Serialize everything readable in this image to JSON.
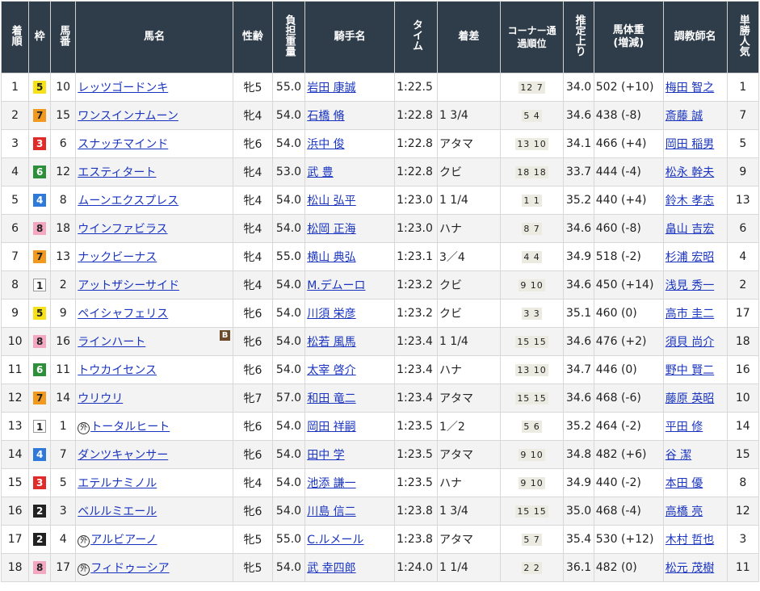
{
  "headers": {
    "finish": "着順",
    "waku": "枠",
    "umaban": "馬番",
    "horse": "馬名",
    "sexage": "性齢",
    "weight_carried": "負担重量",
    "jockey": "騎手名",
    "time": "タイム",
    "margin": "着差",
    "corner": "コーナー通過順位",
    "last3f": "推定上り",
    "body_weight_1": "馬体重",
    "body_weight_2": "(増減)",
    "trainer": "調教師名",
    "popularity": "単勝人気"
  },
  "rows": [
    {
      "finish": "1",
      "waku": "5",
      "umaban": "10",
      "foreign": "",
      "horse": "レッツゴードンキ",
      "blinker": "",
      "sexage": "牝5",
      "kg": "55.0",
      "jockey": "岩田 康誠",
      "time": "1:22.5",
      "margin": "",
      "corner": "12 7",
      "last3f": "34.0",
      "bw": "502 (+10)",
      "trainer": "梅田 智之",
      "pop": "1"
    },
    {
      "finish": "2",
      "waku": "7",
      "umaban": "15",
      "foreign": "",
      "horse": "ワンスインナムーン",
      "blinker": "",
      "sexage": "牝4",
      "kg": "54.0",
      "jockey": "石橋 脩",
      "time": "1:22.8",
      "margin": "1 3/4",
      "corner": "5 4",
      "last3f": "34.6",
      "bw": "438 (-8)",
      "trainer": "斎藤 誠",
      "pop": "7"
    },
    {
      "finish": "3",
      "waku": "3",
      "umaban": "6",
      "foreign": "",
      "horse": "スナッチマインド",
      "blinker": "",
      "sexage": "牝6",
      "kg": "54.0",
      "jockey": "浜中 俊",
      "time": "1:22.8",
      "margin": "アタマ",
      "corner": "13 10",
      "last3f": "34.1",
      "bw": "466 (+4)",
      "trainer": "岡田 稲男",
      "pop": "5"
    },
    {
      "finish": "4",
      "waku": "6",
      "umaban": "12",
      "foreign": "",
      "horse": "エスティタート",
      "blinker": "",
      "sexage": "牝4",
      "kg": "53.0",
      "jockey": "武 豊",
      "time": "1:22.8",
      "margin": "クビ",
      "corner": "18 18",
      "last3f": "33.7",
      "bw": "444 (-4)",
      "trainer": "松永 幹夫",
      "pop": "9"
    },
    {
      "finish": "5",
      "waku": "4",
      "umaban": "8",
      "foreign": "",
      "horse": "ムーンエクスプレス",
      "blinker": "",
      "sexage": "牝4",
      "kg": "54.0",
      "jockey": "松山 弘平",
      "time": "1:23.0",
      "margin": "1 1/4",
      "corner": "1 1",
      "last3f": "35.2",
      "bw": "440 (+4)",
      "trainer": "鈴木 孝志",
      "pop": "13"
    },
    {
      "finish": "6",
      "waku": "8",
      "umaban": "18",
      "foreign": "",
      "horse": "ウインファビラス",
      "blinker": "",
      "sexage": "牝4",
      "kg": "54.0",
      "jockey": "松岡 正海",
      "time": "1:23.0",
      "margin": "ハナ",
      "corner": "8 7",
      "last3f": "34.6",
      "bw": "460 (-8)",
      "trainer": "畠山 吉宏",
      "pop": "6"
    },
    {
      "finish": "7",
      "waku": "7",
      "umaban": "13",
      "foreign": "",
      "horse": "ナックビーナス",
      "blinker": "",
      "sexage": "牝4",
      "kg": "55.0",
      "jockey": "横山 典弘",
      "time": "1:23.1",
      "margin": "3／4",
      "corner": "4 4",
      "last3f": "34.9",
      "bw": "518 (-2)",
      "trainer": "杉浦 宏昭",
      "pop": "4"
    },
    {
      "finish": "8",
      "waku": "1",
      "umaban": "2",
      "foreign": "",
      "horse": "アットザシーサイド",
      "blinker": "",
      "sexage": "牝4",
      "kg": "54.0",
      "jockey": "M.デムーロ",
      "time": "1:23.2",
      "margin": "クビ",
      "corner": "9 10",
      "last3f": "34.6",
      "bw": "450 (+14)",
      "trainer": "浅見 秀一",
      "pop": "2"
    },
    {
      "finish": "9",
      "waku": "5",
      "umaban": "9",
      "foreign": "",
      "horse": "ペイシャフェリス",
      "blinker": "",
      "sexage": "牝6",
      "kg": "54.0",
      "jockey": "川須 栄彦",
      "time": "1:23.2",
      "margin": "クビ",
      "corner": "3 3",
      "last3f": "35.1",
      "bw": "460 (0)",
      "trainer": "高市 圭二",
      "pop": "17"
    },
    {
      "finish": "10",
      "waku": "8",
      "umaban": "16",
      "foreign": "",
      "horse": "ラインハート",
      "blinker": "B",
      "sexage": "牝6",
      "kg": "54.0",
      "jockey": "松若 風馬",
      "time": "1:23.4",
      "margin": "1 1/4",
      "corner": "15 15",
      "last3f": "34.6",
      "bw": "476 (+2)",
      "trainer": "須貝 尚介",
      "pop": "18"
    },
    {
      "finish": "11",
      "waku": "6",
      "umaban": "11",
      "foreign": "",
      "horse": "トウカイセンス",
      "blinker": "",
      "sexage": "牝6",
      "kg": "54.0",
      "jockey": "太宰 啓介",
      "time": "1:23.4",
      "margin": "ハナ",
      "corner": "13 10",
      "last3f": "34.7",
      "bw": "446 (0)",
      "trainer": "野中 賢二",
      "pop": "16"
    },
    {
      "finish": "12",
      "waku": "7",
      "umaban": "14",
      "foreign": "",
      "horse": "ウリウリ",
      "blinker": "",
      "sexage": "牝7",
      "kg": "57.0",
      "jockey": "和田 竜二",
      "time": "1:23.4",
      "margin": "アタマ",
      "corner": "15 15",
      "last3f": "34.6",
      "bw": "468 (-6)",
      "trainer": "藤原 英昭",
      "pop": "10"
    },
    {
      "finish": "13",
      "waku": "1",
      "umaban": "1",
      "foreign": "外",
      "horse": "トータルヒート",
      "blinker": "",
      "sexage": "牝6",
      "kg": "54.0",
      "jockey": "岡田 祥嗣",
      "time": "1:23.5",
      "margin": "1／2",
      "corner": "5 6",
      "last3f": "35.2",
      "bw": "464 (-2)",
      "trainer": "平田 修",
      "pop": "14"
    },
    {
      "finish": "14",
      "waku": "4",
      "umaban": "7",
      "foreign": "",
      "horse": "ダンツキャンサー",
      "blinker": "",
      "sexage": "牝6",
      "kg": "54.0",
      "jockey": "田中 学",
      "time": "1:23.5",
      "margin": "アタマ",
      "corner": "9 10",
      "last3f": "34.8",
      "bw": "482 (+6)",
      "trainer": "谷 潔",
      "pop": "15"
    },
    {
      "finish": "15",
      "waku": "3",
      "umaban": "5",
      "foreign": "",
      "horse": "エテルナミノル",
      "blinker": "",
      "sexage": "牝4",
      "kg": "54.0",
      "jockey": "池添 謙一",
      "time": "1:23.5",
      "margin": "ハナ",
      "corner": "9 10",
      "last3f": "34.9",
      "bw": "440 (-2)",
      "trainer": "本田 優",
      "pop": "8"
    },
    {
      "finish": "16",
      "waku": "2",
      "umaban": "3",
      "foreign": "",
      "horse": "ベルルミエール",
      "blinker": "",
      "sexage": "牝6",
      "kg": "54.0",
      "jockey": "川島 信二",
      "time": "1:23.8",
      "margin": "1 3/4",
      "corner": "15 15",
      "last3f": "35.0",
      "bw": "468 (-4)",
      "trainer": "高橋 亮",
      "pop": "12"
    },
    {
      "finish": "17",
      "waku": "2",
      "umaban": "4",
      "foreign": "外",
      "horse": "アルビアーノ",
      "blinker": "",
      "sexage": "牝5",
      "kg": "55.0",
      "jockey": "C.ルメール",
      "time": "1:23.8",
      "margin": "アタマ",
      "corner": "5 7",
      "last3f": "35.4",
      "bw": "530 (+12)",
      "trainer": "木村 哲也",
      "pop": "3"
    },
    {
      "finish": "18",
      "waku": "8",
      "umaban": "17",
      "foreign": "外",
      "horse": "フィドゥーシア",
      "blinker": "",
      "sexage": "牝5",
      "kg": "54.0",
      "jockey": "武 幸四郎",
      "time": "1:24.0",
      "margin": "1 1/4",
      "corner": "2 2",
      "last3f": "36.1",
      "bw": "482 (0)",
      "trainer": "松元 茂樹",
      "pop": "11"
    }
  ],
  "colors": {
    "header_bg": "#2f3d4b",
    "link": "#1a34c0",
    "row_alt": "#f3f3f3"
  }
}
